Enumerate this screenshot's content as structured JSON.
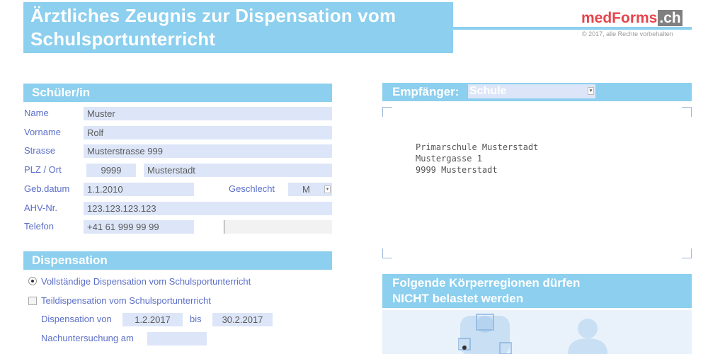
{
  "header": {
    "title_line1": "Ärztliches Zeugnis zur Dispensation vom",
    "title_line2": "Schulsportunterricht",
    "brand_main": "medForms",
    "brand_tld": ".ch",
    "copyright": "© 2017, alle Rechte vorbehalten"
  },
  "student": {
    "section_title": "Schüler/in",
    "name_label": "Name",
    "name_value": "Muster",
    "firstname_label": "Vorname",
    "firstname_value": "Rolf",
    "street_label": "Strasse",
    "street_value": "Musterstrasse 999",
    "zip_city_label": "PLZ / Ort",
    "zip_value": "9999",
    "city_value": "Musterstadt",
    "birthdate_label": "Geb.datum",
    "birthdate_value": "1.1.2010",
    "gender_label": "Geschlecht",
    "gender_value": "M",
    "ahv_label": "AHV-Nr.",
    "ahv_value": "123.123.123.123",
    "phone_label": "Telefon",
    "phone_value": "+41 61 999 99 99",
    "phone2_value": ""
  },
  "recipient": {
    "label": "Empfänger:",
    "selected": "Schule",
    "address_lines": [
      "Primarschule Musterstadt",
      "Mustergasse 1",
      "9999 Musterstadt"
    ]
  },
  "dispensation": {
    "section_title": "Dispensation",
    "full_label": "Vollständige Dispensation vom Schulsportunterricht",
    "full_selected": true,
    "partial_label": "Teildispensation vom Schulsportunterricht",
    "partial_checked": false,
    "from_label": "Dispensation von",
    "from_value": "1.2.2017",
    "to_label": "bis",
    "to_value": "30.2.2017",
    "followup_label": "Nachuntersuchung am",
    "followup_value": ""
  },
  "body_regions": {
    "title_line1": "Folgende Körperregionen dürfen",
    "title_line2": "NICHT belastet werden"
  },
  "colors": {
    "accent": "#8ccfee",
    "field_bg": "#dde6f8",
    "label": "#5b6fc8",
    "brand_red": "#e8434a"
  },
  "icons": [
    "dropdown-arrow-icon",
    "body-figure-front-icon",
    "body-figure-back-icon"
  ]
}
